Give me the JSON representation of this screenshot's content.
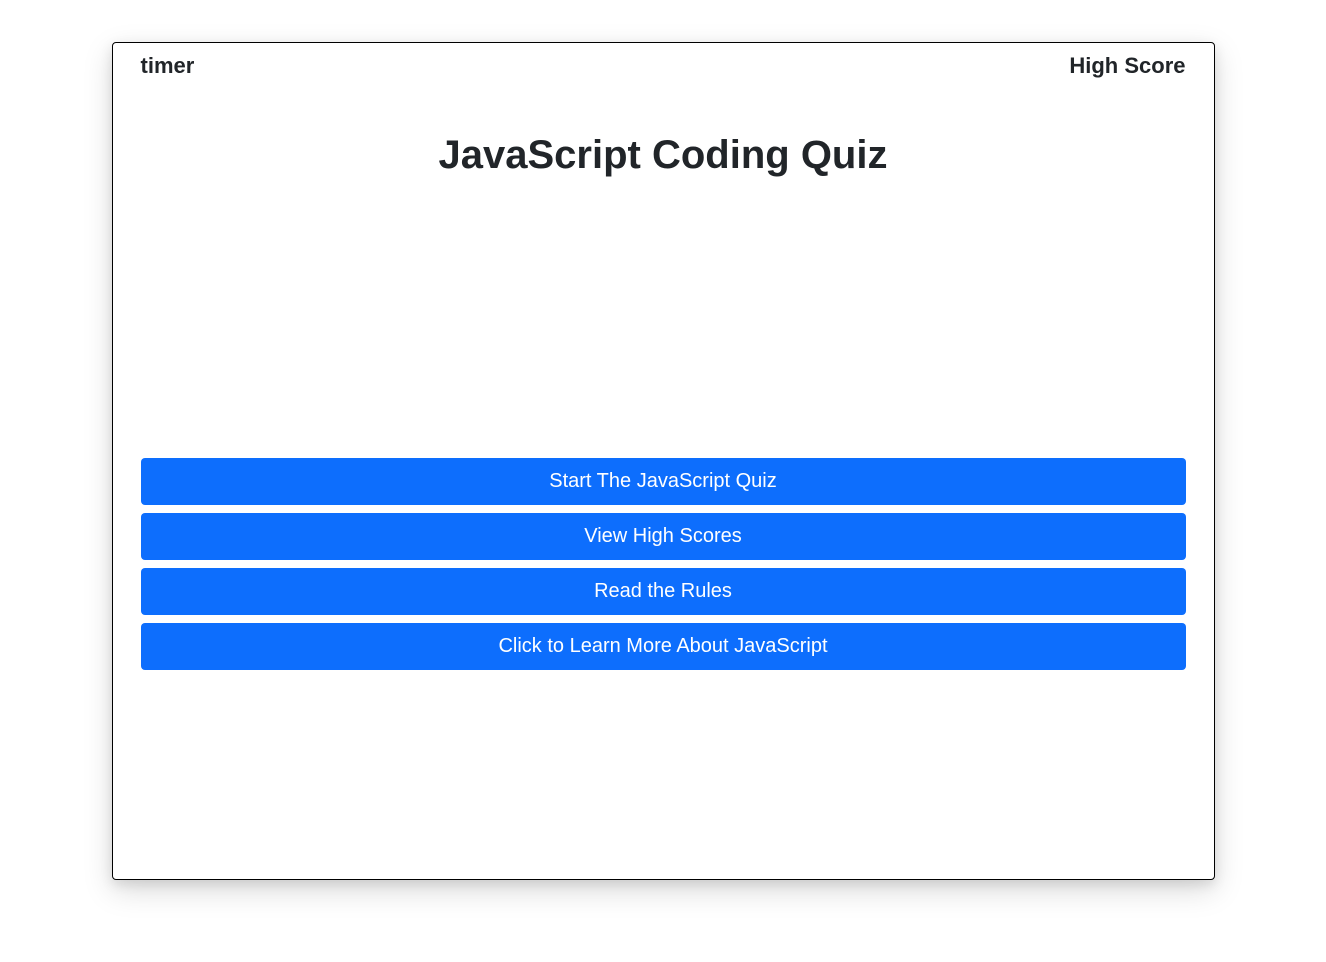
{
  "header": {
    "timer_label": "timer",
    "high_score_label": "High Score"
  },
  "title": "JavaScript Coding Quiz",
  "buttons": {
    "start_quiz": "Start The JavaScript Quiz",
    "view_scores": "View High Scores",
    "read_rules": "Read the Rules",
    "learn_more": "Click to Learn More About JavaScript"
  },
  "colors": {
    "button_bg": "#0d6efd",
    "button_text": "#ffffff",
    "text": "#212529"
  }
}
